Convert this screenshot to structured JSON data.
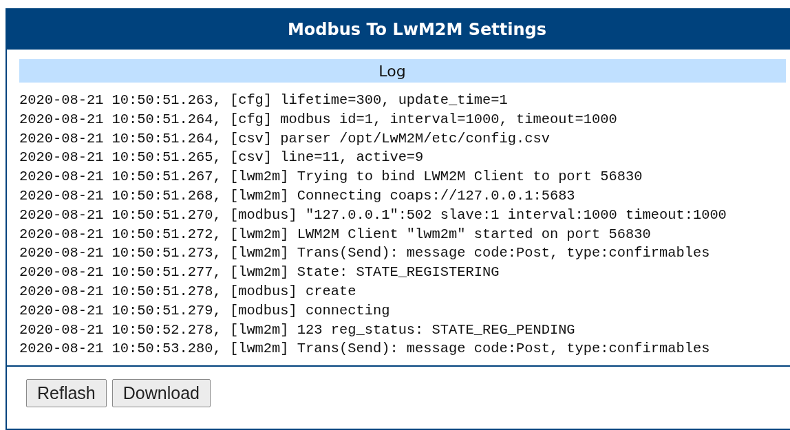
{
  "panel": {
    "title": "Modbus To LwM2M Settings"
  },
  "log": {
    "title": "Log",
    "lines": [
      "2020-08-21 10:50:51.263, [cfg] lifetime=300, update_time=1",
      "2020-08-21 10:50:51.264, [cfg] modbus id=1, interval=1000, timeout=1000",
      "2020-08-21 10:50:51.264, [csv] parser /opt/LwM2M/etc/config.csv",
      "2020-08-21 10:50:51.265, [csv] line=11, active=9",
      "2020-08-21 10:50:51.267, [lwm2m] Trying to bind LWM2M Client to port 56830",
      "2020-08-21 10:50:51.268, [lwm2m] Connecting coaps://127.0.0.1:5683",
      "2020-08-21 10:50:51.270, [modbus] \"127.0.0.1\":502 slave:1 interval:1000 timeout:1000",
      "2020-08-21 10:50:51.272, [lwm2m] LWM2M Client \"lwm2m\" started on port 56830",
      "2020-08-21 10:50:51.273, [lwm2m] Trans(Send): message code:Post, type:confirmables",
      "2020-08-21 10:50:51.277, [lwm2m] State: STATE_REGISTERING",
      "2020-08-21 10:50:51.278, [modbus] create",
      "2020-08-21 10:50:51.279, [modbus] connecting",
      "2020-08-21 10:50:52.278, [lwm2m] 123 reg_status: STATE_REG_PENDING",
      "2020-08-21 10:50:53.280, [lwm2m] Trans(Send): message code:Post, type:confirmables"
    ]
  },
  "buttons": [
    "Reflash",
    "Download"
  ]
}
